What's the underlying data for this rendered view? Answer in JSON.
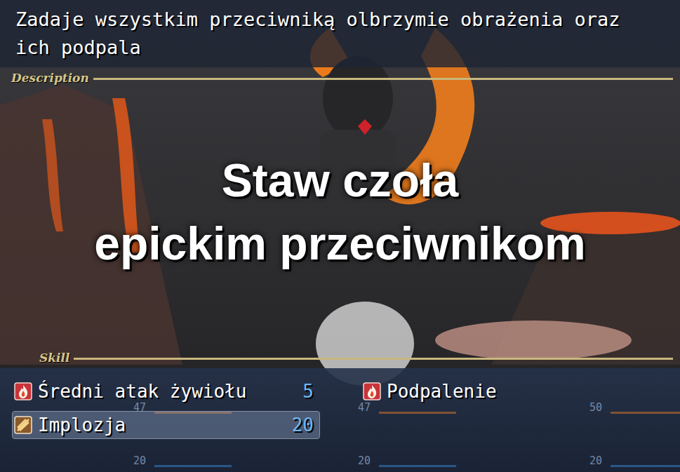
{
  "description": {
    "label": "Description",
    "text": "Zadaje wszystkim przeciwniką olbrzymie obrażenia oraz ich podpala"
  },
  "caption": {
    "lines": [
      "Staw czoła",
      "epickim przeciwnikom"
    ]
  },
  "skill_window": {
    "label": "Skill"
  },
  "skills": [
    {
      "name": "Średni atak żywiołu",
      "cost": "5",
      "kind": "fire",
      "selected": false
    },
    {
      "name": "Podpalenie",
      "cost": "",
      "kind": "fire",
      "selected": false
    },
    {
      "name": "Implozja",
      "cost": "20",
      "kind": "burst",
      "selected": true
    }
  ],
  "party": [
    {
      "hp": "47",
      "mp": "20"
    },
    {
      "hp": "47",
      "mp": "20"
    },
    {
      "hp": "50",
      "mp": "20"
    }
  ]
}
